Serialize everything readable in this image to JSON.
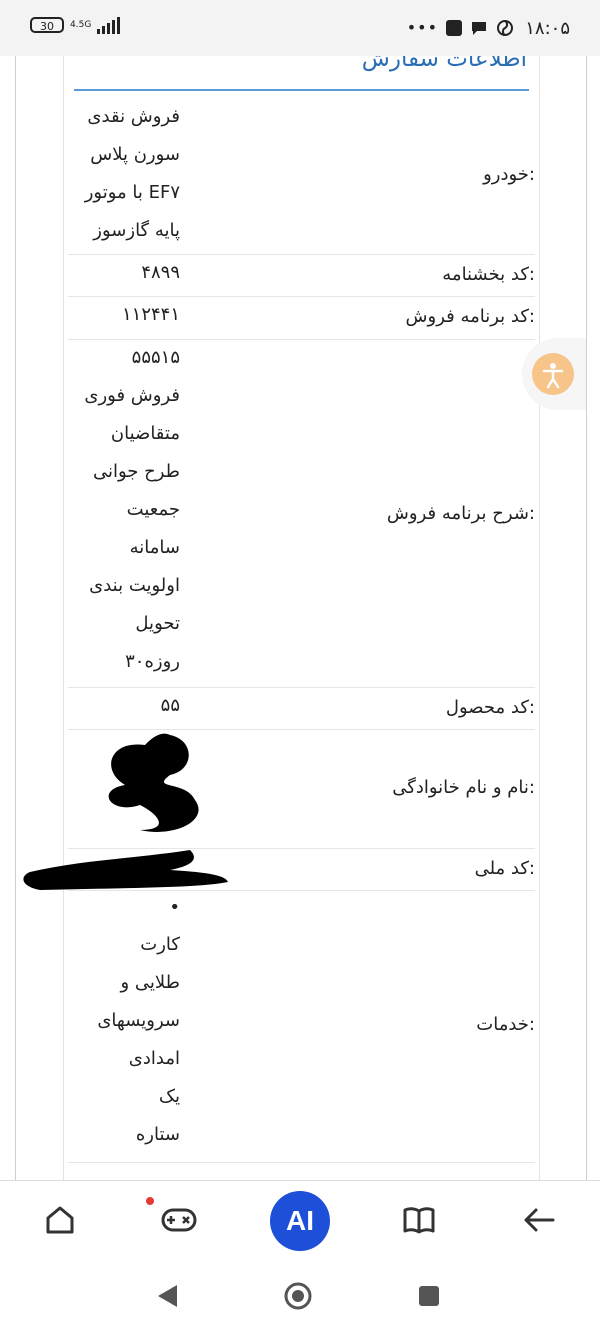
{
  "status_bar": {
    "time": "۱۸:۰۵",
    "battery": "30",
    "network": "4.5G",
    "more": "•••"
  },
  "card": {
    "title": "اطلاعات سفارش"
  },
  "rows": {
    "car": {
      "label": "خودرو:",
      "lines": [
        "فروش نقدی",
        "سورن پلاس",
        "با موتور EF۷",
        "پایه گازسوز"
      ]
    },
    "circular_code": {
      "label": "کد بخشنامه:",
      "value": "۴۸۹۹"
    },
    "sales_program_code": {
      "label": "کد برنامه فروش:",
      "value": "۱۱۲۴۴۱"
    },
    "sales_program_desc": {
      "label": "شرح برنامه فروش:",
      "lines": [
        "۵۵۵۱۵",
        "فروش فوری",
        "متقاضیان",
        "طرح جوانی",
        "جمعیت",
        "سامانه",
        "اولویت بندی",
        "تحویل",
        "۳۰روزه"
      ]
    },
    "product_code": {
      "label": "کد محصول:",
      "value": "۵۵"
    },
    "full_name": {
      "label": "نام و نام خانوادگی:"
    },
    "national_code": {
      "label": "کد ملی:"
    },
    "services": {
      "label": "خدمات:",
      "bullet": "•",
      "lines": [
        "کارت",
        "طلایی و",
        "سرویسهای",
        "امدادی",
        "یک",
        "ستاره"
      ]
    }
  },
  "bottom_nav": {
    "ai_label": "AI",
    "items": [
      "home-icon",
      "game-icon",
      "ai-button",
      "book-icon",
      "back-arrow-icon"
    ]
  },
  "colors": {
    "title": "#2a6fb5",
    "title_line": "#5c9bd6",
    "accessibility": "#f7c48a",
    "ai_button": "#1d4fd8",
    "notification_dot": "#e53935"
  }
}
